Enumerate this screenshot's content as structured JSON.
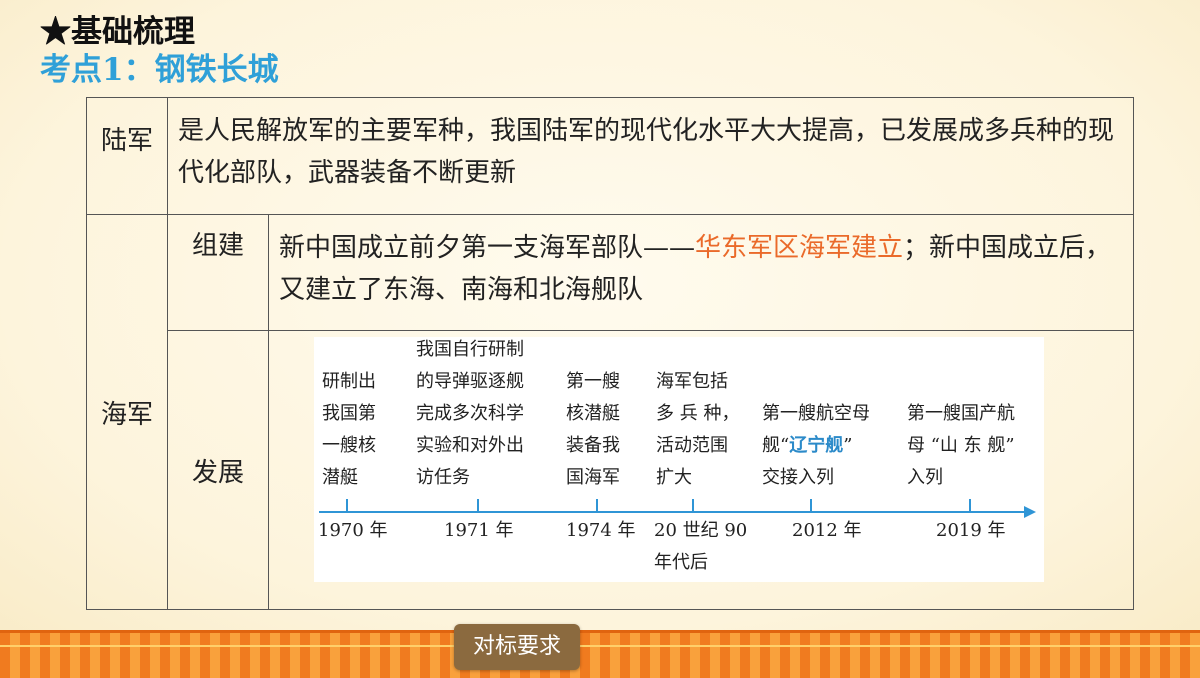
{
  "header": {
    "title": "★基础梳理",
    "subtitle": "考点1：钢铁长城"
  },
  "table": {
    "army": {
      "label": "陆军",
      "text": "是人民解放军的主要军种，我国陆军的现代化水平大大提高，已发展成多兵种的现代化部队，武器装备不断更新"
    },
    "navy": {
      "label": "海军",
      "build": {
        "label": "组建",
        "text_before": "新中国成立前夕第一支海军部队——",
        "highlight": "华东军区海军建立",
        "text_after": "；新中国成立后，又建立了东海、南海和北海舰队"
      },
      "development": {
        "label": "发展",
        "timeline": [
          {
            "desc": [
              "研制出",
              "我国第",
              "一艘核",
              "潜艇"
            ],
            "year": [
              "1970 年"
            ]
          },
          {
            "desc": [
              "我国自行研制",
              "的导弹驱逐舰",
              "完成多次科学",
              "实验和对外出",
              "访任务"
            ],
            "year": [
              "1971 年"
            ]
          },
          {
            "desc": [
              "第一艘",
              "核潜艇",
              "装备我",
              "国海军"
            ],
            "year": [
              "1974 年"
            ]
          },
          {
            "desc": [
              "海军包括",
              "多 兵 种，",
              "活动范围",
              "扩大"
            ],
            "year": [
              "20 世纪 90",
              "年代后"
            ]
          },
          {
            "desc_pre": "第一艘航空母",
            "desc_l2a": "舰“",
            "desc_l2b": "辽宁舰",
            "desc_l2c": "”",
            "desc_l3": "交接入列",
            "year": [
              "2012 年"
            ]
          },
          {
            "desc": [
              "第一艘国产航",
              "母 “山 东 舰”",
              "入列"
            ],
            "year": [
              "2019 年"
            ]
          }
        ],
        "accent_color": "#2f95d6"
      }
    }
  },
  "footer": {
    "button_label": "对标要求"
  },
  "colors": {
    "subtitle": "#2fa0d8",
    "highlight": "#ea6a2a",
    "footer_button": "#8b6a3f"
  }
}
